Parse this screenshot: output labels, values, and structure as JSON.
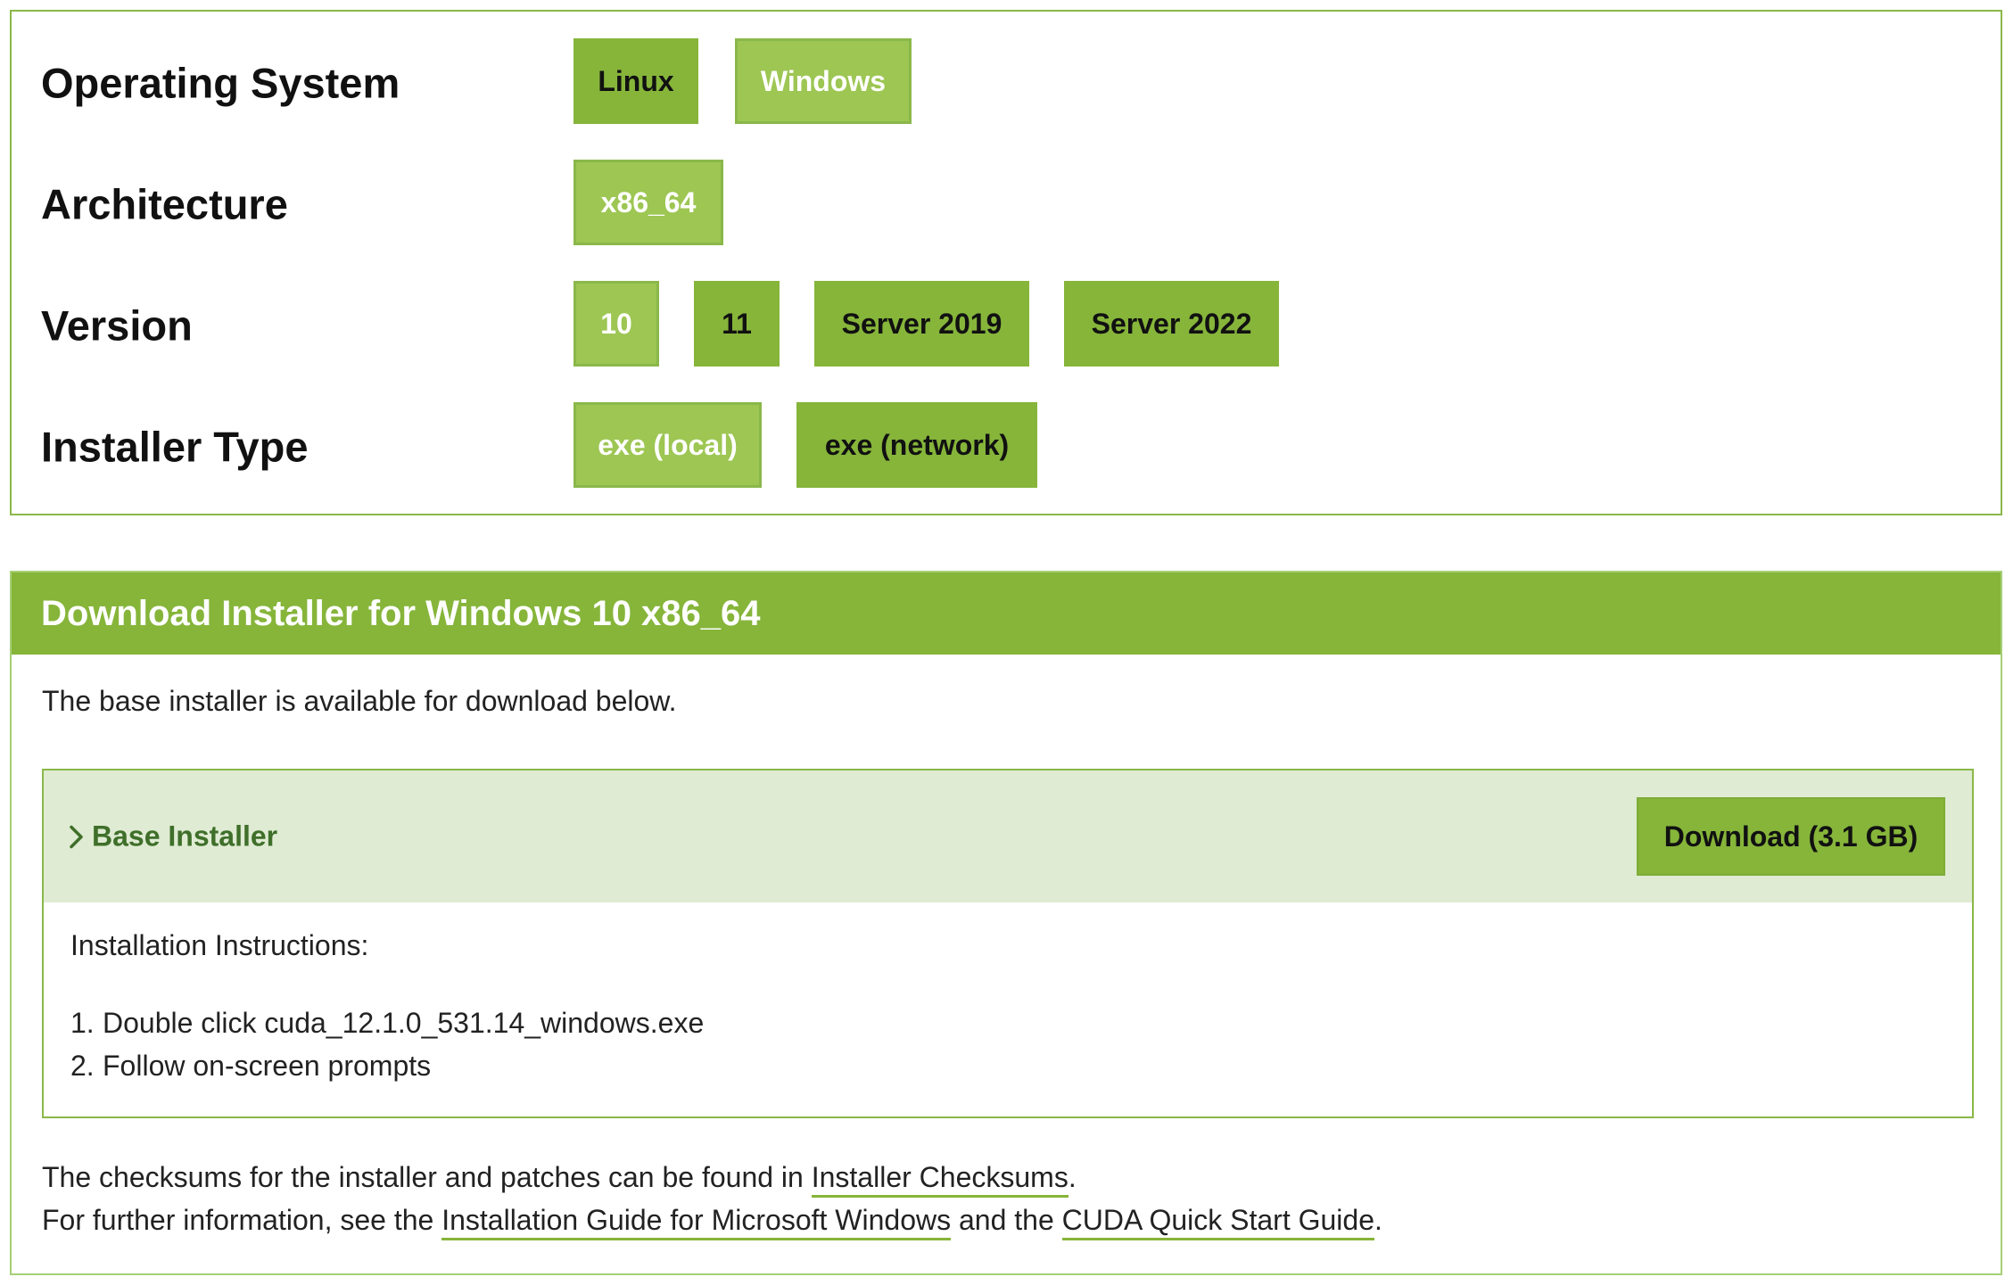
{
  "selector": {
    "rows": [
      {
        "label": "Operating System",
        "options": [
          {
            "label": "Linux",
            "selected": false
          },
          {
            "label": "Windows",
            "selected": true
          }
        ]
      },
      {
        "label": "Architecture",
        "options": [
          {
            "label": "x86_64",
            "selected": true
          }
        ]
      },
      {
        "label": "Version",
        "options": [
          {
            "label": "10",
            "selected": true
          },
          {
            "label": "11",
            "selected": false
          },
          {
            "label": "Server 2019",
            "selected": false
          },
          {
            "label": "Server 2022",
            "selected": false
          }
        ]
      },
      {
        "label": "Installer Type",
        "options": [
          {
            "label": "exe (local)",
            "selected": true
          },
          {
            "label": "exe (network)",
            "selected": false
          }
        ]
      }
    ]
  },
  "download": {
    "title": "Download Installer for Windows 10 x86_64",
    "intro": "The base installer is available for download below.",
    "installer": {
      "name": "Base Installer",
      "button_label": "Download (3.1 GB)",
      "instructions_title": "Installation Instructions:",
      "steps": [
        {
          "num": "1.",
          "text": "Double click cuda_12.1.0_531.14_windows.exe"
        },
        {
          "num": "2.",
          "text": "Follow on-screen prompts"
        }
      ]
    },
    "footer": {
      "line1_prefix": "The checksums for the installer and patches can be found in ",
      "line1_link": "Installer Checksums",
      "line1_suffix": ".",
      "line2_prefix": "For further information, see the ",
      "line2_link1": "Installation Guide for Microsoft Windows",
      "line2_mid": " and the ",
      "line2_link2": "CUDA Quick Start Guide",
      "line2_suffix": "."
    }
  },
  "colors": {
    "accent": "#86b53a",
    "selected_option": "#9dc653",
    "installer_header_bg": "#dfebd3",
    "installer_name": "#3f6f2a"
  },
  "icons": {
    "installer_toggle": "chevron-right-icon"
  }
}
